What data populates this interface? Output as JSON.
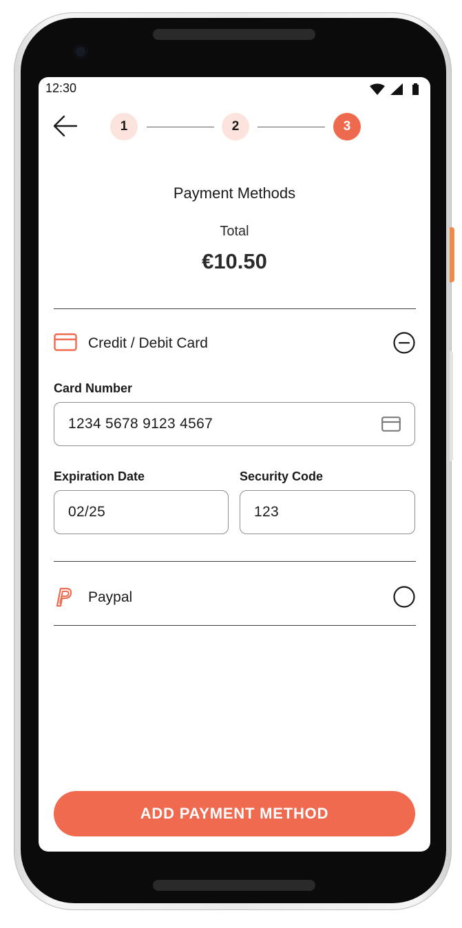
{
  "status_bar": {
    "time": "12:30"
  },
  "stepper": {
    "steps": [
      "1",
      "2",
      "3"
    ],
    "active_step": 3
  },
  "header": {
    "title": "Payment Methods",
    "total_label": "Total",
    "total_amount": "€10.50"
  },
  "methods": {
    "card": {
      "label": "Credit / Debit Card",
      "expanded": true,
      "card_number_label": "Card Number",
      "card_number_value": "1234 5678 9123 4567",
      "expiration_label": "Expiration Date",
      "expiration_value": "02/25",
      "security_label": "Security Code",
      "security_value": "123"
    },
    "paypal": {
      "label": "Paypal",
      "selected": false
    }
  },
  "cta": {
    "label": "ADD PAYMENT METHOD"
  },
  "colors": {
    "accent": "#ef6a4f",
    "step_done_bg": "#fde3dd",
    "text": "#1a1a1a"
  },
  "icons": [
    "back-arrow-icon",
    "credit-card-icon",
    "collapse-minus-icon",
    "paypal-icon",
    "radio-unchecked-icon",
    "wifi-icon",
    "signal-icon",
    "battery-icon"
  ]
}
